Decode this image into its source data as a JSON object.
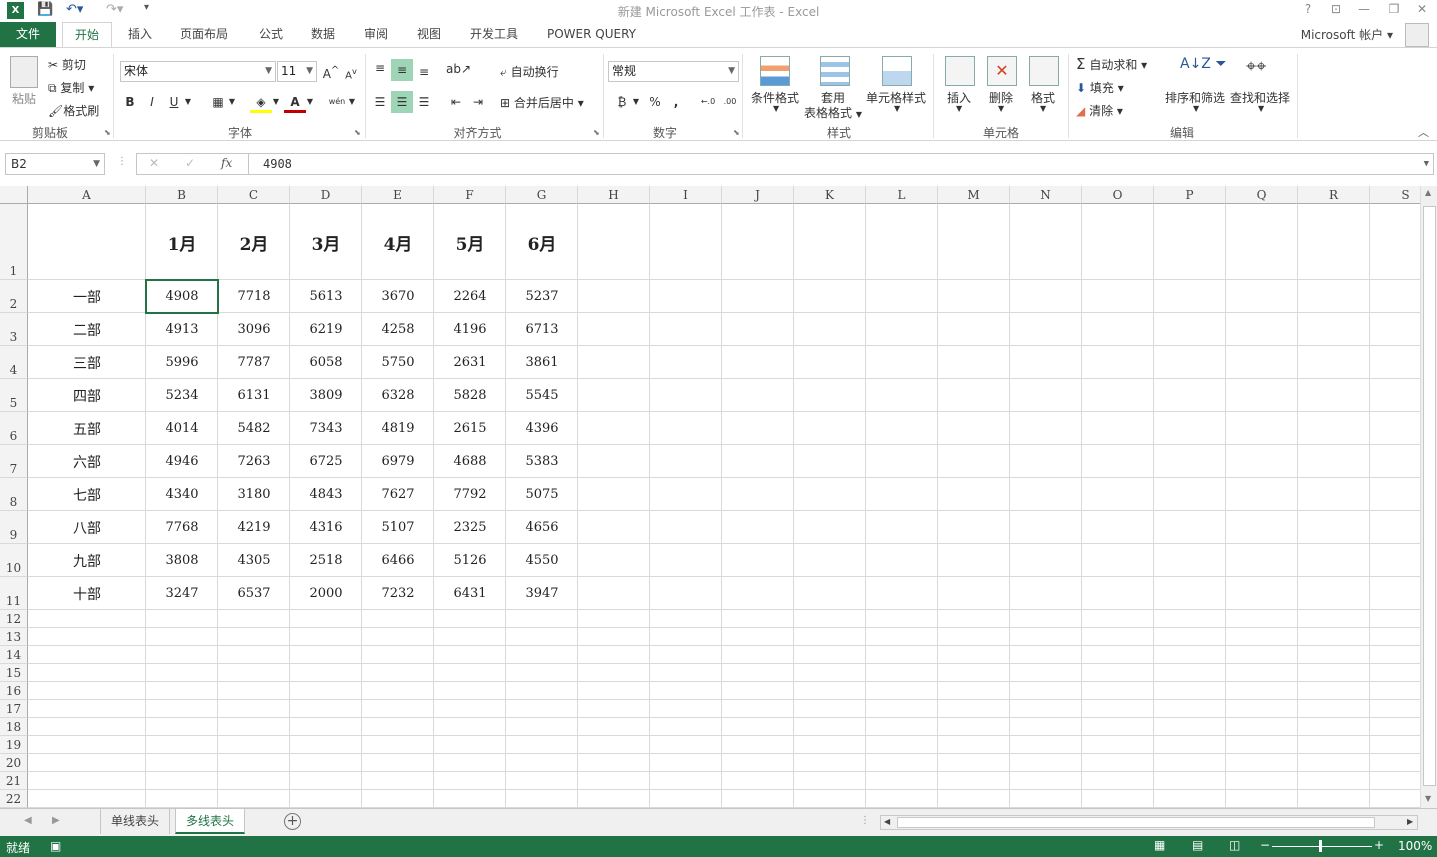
{
  "window": {
    "title": "新建 Microsoft Excel 工作表 - Excel",
    "help": "?",
    "controls": [
      "?",
      "⊡",
      "—",
      "❐",
      "✕"
    ]
  },
  "tabs": [
    "文件",
    "开始",
    "插入",
    "页面布局",
    "公式",
    "数据",
    "审阅",
    "视图",
    "开发工具",
    "POWER QUERY"
  ],
  "active_tab": "开始",
  "account": "Microsoft 帐户",
  "ribbon": {
    "clipboard": {
      "paste": "粘贴",
      "cut": "剪切",
      "copy": "复制",
      "format_painter": "格式刷",
      "label": "剪贴板"
    },
    "font": {
      "name": "宋体",
      "size": "11",
      "label": "字体",
      "bold": "B",
      "italic": "I",
      "underline": "U",
      "phonetic": "wén"
    },
    "alignment": {
      "wrap": "自动换行",
      "merge": "合并后居中",
      "label": "对齐方式"
    },
    "number": {
      "format": "常规",
      "percent": "%",
      "comma": ",",
      "label": "数字"
    },
    "styles": {
      "conditional": "条件格式",
      "table_line1": "套用",
      "table_line2": "表格格式",
      "cell_styles": "单元格样式",
      "label": "样式"
    },
    "cells": {
      "insert": "插入",
      "delete": "删除",
      "format": "格式",
      "label": "单元格"
    },
    "editing": {
      "autosum": "自动求和",
      "fill": "填充",
      "clear": "清除",
      "sort": "排序和筛选",
      "find": "查找和选择",
      "label": "编辑"
    }
  },
  "formula_bar": {
    "name_box": "B2",
    "fx": "fx",
    "value": "4908"
  },
  "columns": [
    "A",
    "B",
    "C",
    "D",
    "E",
    "F",
    "G",
    "H",
    "I",
    "J",
    "K",
    "L",
    "M",
    "N",
    "O",
    "P",
    "Q",
    "R",
    "S"
  ],
  "rows": [
    "1",
    "2",
    "3",
    "4",
    "5",
    "6",
    "7",
    "8",
    "9",
    "10",
    "11",
    "12",
    "13",
    "14",
    "15",
    "16",
    "17",
    "18",
    "19",
    "20",
    "21",
    "22"
  ],
  "sheet": {
    "header": [
      "",
      "1月",
      "2月",
      "3月",
      "4月",
      "5月",
      "6月"
    ],
    "data": [
      [
        "一部",
        "4908",
        "7718",
        "5613",
        "3670",
        "2264",
        "5237"
      ],
      [
        "二部",
        "4913",
        "3096",
        "6219",
        "4258",
        "4196",
        "6713"
      ],
      [
        "三部",
        "5996",
        "7787",
        "6058",
        "5750",
        "2631",
        "3861"
      ],
      [
        "四部",
        "5234",
        "6131",
        "3809",
        "6328",
        "5828",
        "5545"
      ],
      [
        "五部",
        "4014",
        "5482",
        "7343",
        "4819",
        "2615",
        "4396"
      ],
      [
        "六部",
        "4946",
        "7263",
        "6725",
        "6979",
        "4688",
        "5383"
      ],
      [
        "七部",
        "4340",
        "3180",
        "4843",
        "7627",
        "7792",
        "5075"
      ],
      [
        "八部",
        "7768",
        "4219",
        "4316",
        "5107",
        "2325",
        "4656"
      ],
      [
        "九部",
        "3808",
        "4305",
        "2518",
        "6466",
        "5126",
        "4550"
      ],
      [
        "十部",
        "3247",
        "6537",
        "2000",
        "7232",
        "6431",
        "3947"
      ]
    ]
  },
  "sheet_tabs": [
    "单线表头",
    "多线表头"
  ],
  "active_sheet": "多线表头",
  "status": {
    "ready": "就绪",
    "zoom": "100%"
  }
}
